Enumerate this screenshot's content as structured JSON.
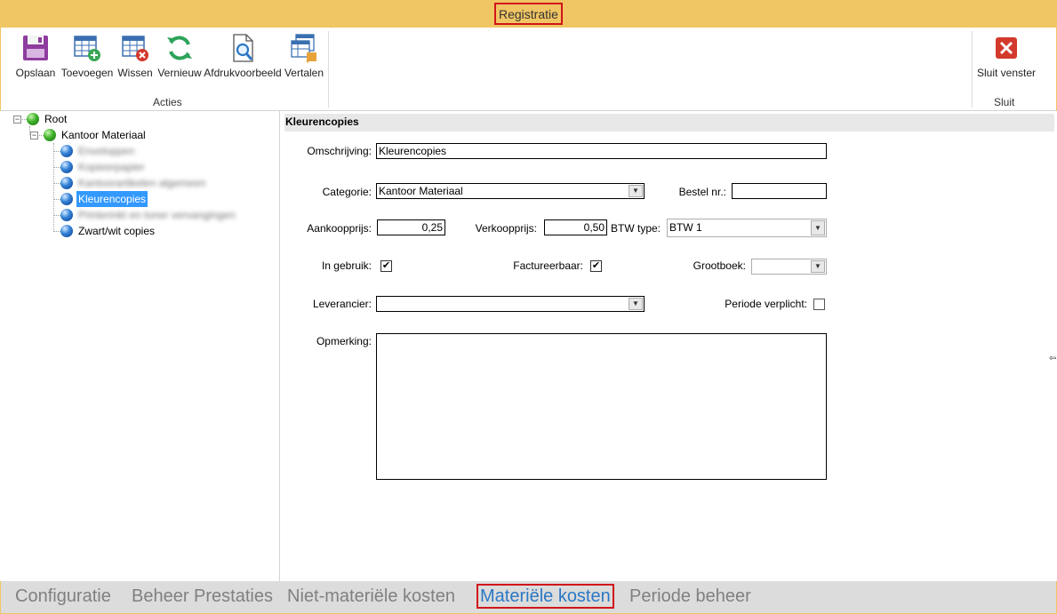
{
  "window": {
    "title": "Registratie"
  },
  "ribbon": {
    "acties": {
      "label": "Acties",
      "buttons": [
        {
          "label": "Opslaan",
          "icon": "save-icon"
        },
        {
          "label": "Toevoegen",
          "icon": "add-row-icon"
        },
        {
          "label": "Wissen",
          "icon": "delete-row-icon"
        },
        {
          "label": "Vernieuw",
          "icon": "refresh-icon"
        },
        {
          "label": "Afdrukvoorbeeld",
          "icon": "print-preview-icon"
        },
        {
          "label": "Vertalen",
          "icon": "translate-icon"
        }
      ]
    },
    "sluit": {
      "label": "Sluit",
      "button": {
        "label": "Sluit venster",
        "icon": "close-window-icon"
      }
    }
  },
  "tree": {
    "root": "Root",
    "category": "Kantoor Materiaal",
    "items": [
      {
        "label": "Enveloppen",
        "blurred": true
      },
      {
        "label": "Kopieerpapier",
        "blurred": true
      },
      {
        "label": "Kantoorartikelen algemeen",
        "blurred": true
      },
      {
        "label": "Kleurencopies",
        "selected": true
      },
      {
        "label": "Printerinkt en toner vervangingen",
        "blurred": true
      },
      {
        "label": "Zwart/wit copies"
      }
    ]
  },
  "form": {
    "header": "Kleurencopies",
    "omschrijving": {
      "label": "Omschrijving:",
      "value": "Kleurencopies"
    },
    "categorie": {
      "label": "Categorie:",
      "value": "Kantoor Materiaal"
    },
    "bestelnr": {
      "label": "Bestel nr.:",
      "value": ""
    },
    "aankoopprijs": {
      "label": "Aankoopprijs:",
      "value": "0,25"
    },
    "verkoopprijs": {
      "label": "Verkoopprijs:",
      "value": "0,50"
    },
    "btw": {
      "label": "BTW type:",
      "value": "BTW 1"
    },
    "ingebruik": {
      "label": "In gebruik:",
      "checked": true
    },
    "factureerbaar": {
      "label": "Factureerbaar:",
      "checked": true
    },
    "grootboek": {
      "label": "Grootboek:",
      "value": ""
    },
    "leverancier": {
      "label": "Leverancier:",
      "value": ""
    },
    "periode": {
      "label": "Periode verplicht:",
      "checked": false
    },
    "opmerking": {
      "label": "Opmerking:",
      "value": ""
    }
  },
  "tabs": [
    {
      "label": "Configuratie"
    },
    {
      "label": "Beheer Prestaties"
    },
    {
      "label": "Niet-materiële kosten"
    },
    {
      "label": "Materiële kosten",
      "active": true
    },
    {
      "label": "Periode beheer"
    }
  ],
  "colors": {
    "titlebar": "#f0c563",
    "highlight": "#d0141a",
    "selection": "#3399ff",
    "active_tab": "#2b78c5"
  }
}
